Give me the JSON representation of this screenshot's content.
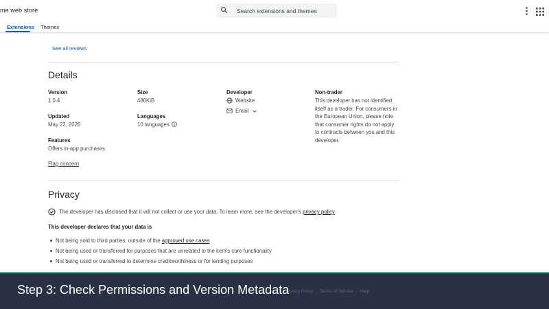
{
  "header": {
    "store_name": "me web store",
    "search_placeholder": "Search extensions and themes",
    "tabs": [
      {
        "label": "Extensions",
        "active": true
      },
      {
        "label": "Themes",
        "active": false
      }
    ]
  },
  "reviews": {
    "see_all": "See all reviews"
  },
  "details": {
    "heading": "Details",
    "version": {
      "label": "Version",
      "value": "1.0.4"
    },
    "size": {
      "label": "Size",
      "value": "480KiB"
    },
    "updated": {
      "label": "Updated",
      "value": "May 22, 2026"
    },
    "languages": {
      "label": "Languages",
      "value": "10 languages"
    },
    "features": {
      "label": "Features",
      "value": "Offers in-app purchases"
    },
    "developer": {
      "label": "Developer",
      "website": "Website",
      "email": "Email"
    },
    "non_trader": {
      "label": "Non-trader",
      "text": "This developer has not identified itself as a trader. For consumers in the European Union, please note that consumer rights do not apply to contracts between you and this developer."
    },
    "flag_concern": "Flag concern"
  },
  "privacy": {
    "heading": "Privacy",
    "disclosure_text": "The developer has disclosed that it will not collect or use your data. To learn more, see the developer's",
    "disclosure_link": "privacy policy",
    "disclosure_end": ".",
    "declares_heading": "This developer declares that your data is",
    "bullets": [
      {
        "text": "Not being sold to third parties, outside of the",
        "link": "approved use cases"
      },
      {
        "text": "Not being used or transferred for purposes that are unrelated to the item's core functionality",
        "link": ""
      },
      {
        "text": "Not being used or transferred to determine creditworthiness or for lending purposes",
        "link": ""
      }
    ]
  },
  "footer": {
    "links": [
      "rivacy Policy",
      "·",
      "Terms of Service",
      "·",
      "Help"
    ]
  },
  "banner": {
    "caption": "Step 3: Check Permissions and Version Metadata"
  },
  "colors": {
    "accent": "#0b57d0",
    "banner": "#21293b",
    "text": "#1f1f1f",
    "muted": "#444746"
  },
  "icons": [
    "search-icon",
    "more-vert-icon",
    "apps-grid-icon",
    "info-icon",
    "globe-icon",
    "mail-icon",
    "chevron-down-icon",
    "check-circle-icon"
  ]
}
